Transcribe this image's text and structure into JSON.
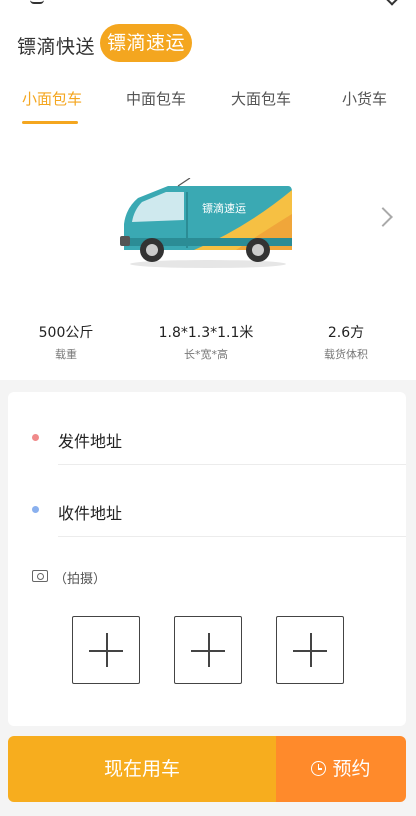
{
  "brand": {
    "express": "镖滴快送",
    "freight": "镖滴速运"
  },
  "tabs": [
    {
      "label": "小面包车",
      "active": true
    },
    {
      "label": "中面包车",
      "active": false
    },
    {
      "label": "大面包车",
      "active": false
    },
    {
      "label": "小货车",
      "active": false
    }
  ],
  "vehicle": {
    "body_text": "镖滴速运",
    "specs": [
      {
        "value": "500公斤",
        "label": "载重"
      },
      {
        "value": "1.8*1.3*1.1米",
        "label": "长*宽*高"
      },
      {
        "value": "2.6方",
        "label": "载货体积"
      }
    ]
  },
  "address": {
    "sender": "发件地址",
    "receiver": "收件地址",
    "sender_dot_color": "#f08a8a",
    "receiver_dot_color": "#8ab0ee"
  },
  "photo": {
    "label": "（拍摄）",
    "slots": 3
  },
  "actions": {
    "now": "现在用车",
    "book": "预约"
  },
  "colors": {
    "accent": "#f4a61f",
    "book_button": "#ff8a2b"
  }
}
